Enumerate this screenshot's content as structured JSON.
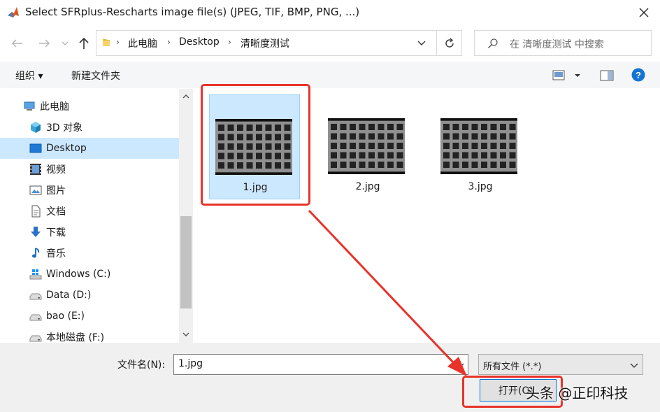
{
  "window": {
    "title": "Select SFRplus-Rescharts image file(s) (JPEG, TIF, BMP, PNG, ...)"
  },
  "address": {
    "crumbs": [
      "此电脑",
      "Desktop",
      "清晰度测试"
    ]
  },
  "search": {
    "placeholder": "在 清晰度测试 中搜索"
  },
  "toolbar": {
    "organize_label": "组织 ▾",
    "new_folder_label": "新建文件夹"
  },
  "sidebar": {
    "items": [
      {
        "label": "此电脑",
        "icon": "computer-icon"
      },
      {
        "label": "3D 对象",
        "icon": "cube-icon"
      },
      {
        "label": "Desktop",
        "icon": "desktop-icon",
        "selected": true
      },
      {
        "label": "视频",
        "icon": "film-icon"
      },
      {
        "label": "图片",
        "icon": "picture-icon"
      },
      {
        "label": "文档",
        "icon": "document-icon"
      },
      {
        "label": "下载",
        "icon": "download-icon"
      },
      {
        "label": "音乐",
        "icon": "music-icon"
      },
      {
        "label": "Windows (C:)",
        "icon": "windows-drive-icon"
      },
      {
        "label": "Data (D:)",
        "icon": "drive-icon"
      },
      {
        "label": "bao (E:)",
        "icon": "drive-icon"
      },
      {
        "label": "本地磁盘 (F:)",
        "icon": "drive-icon"
      }
    ]
  },
  "files": [
    {
      "name": "1.jpg",
      "selected": true
    },
    {
      "name": "2.jpg",
      "selected": false
    },
    {
      "name": "3.jpg",
      "selected": false
    }
  ],
  "bottom": {
    "filename_label": "文件名(N):",
    "filename_value": "1.jpg",
    "filetype_value": "所有文件 (*.*)",
    "open_label": "打开(O)"
  },
  "watermark": {
    "text": "头条 @正印科技"
  },
  "colors": {
    "selection": "#cce8ff",
    "annotation": "#e8332a",
    "accent": "#0078d7"
  }
}
